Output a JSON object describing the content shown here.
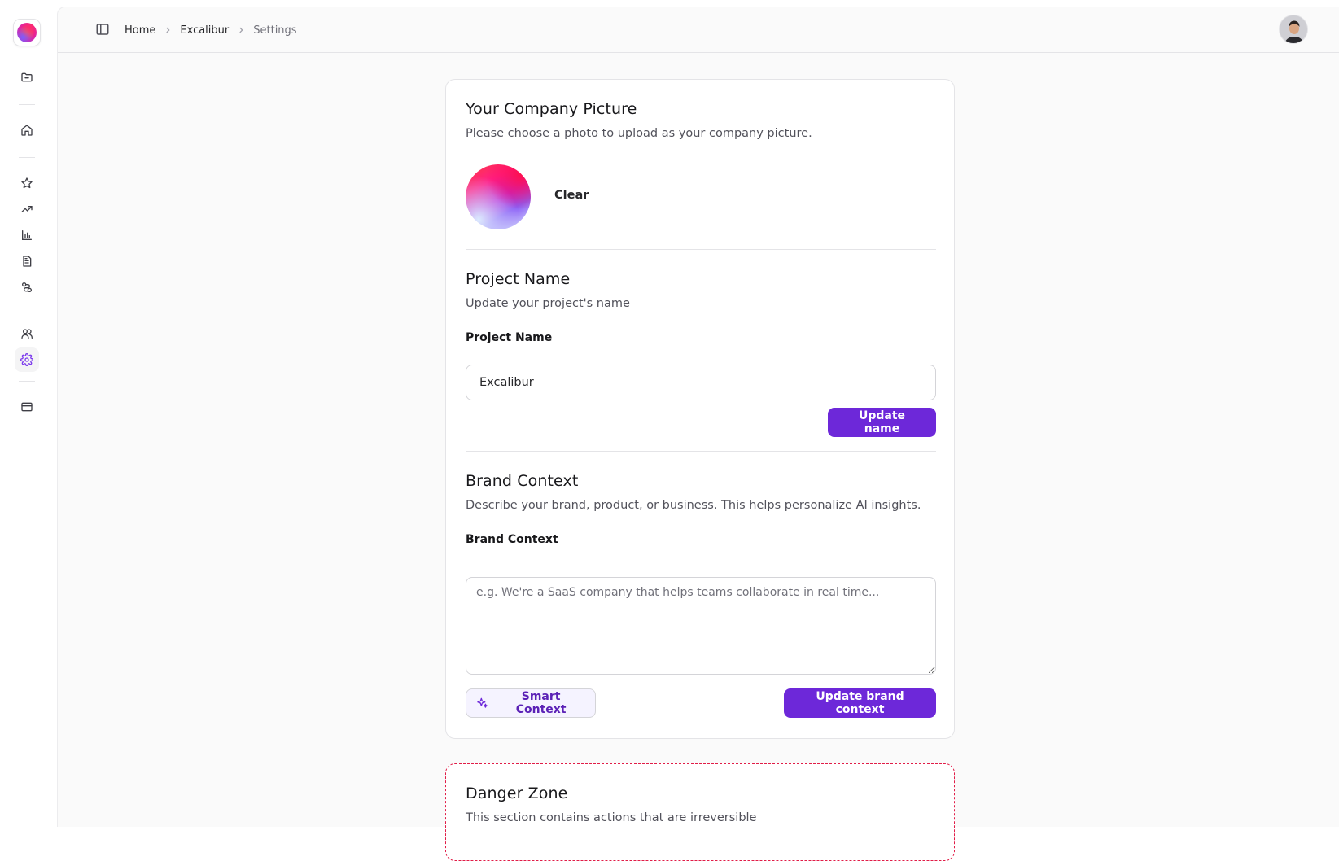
{
  "sidebar": {
    "icons": [
      "folder-icon",
      "home-icon",
      "star-icon",
      "trending-up-icon",
      "bar-chart-icon",
      "document-icon",
      "integrations-icon",
      "users-icon",
      "settings-icon",
      "credit-card-icon"
    ],
    "active": "settings-icon"
  },
  "header": {
    "breadcrumb": [
      "Home",
      "Excalibur",
      "Settings"
    ]
  },
  "company_picture": {
    "title": "Your Company Picture",
    "description": "Please choose a photo to upload as your company picture.",
    "clear_label": "Clear"
  },
  "project_name": {
    "title": "Project Name",
    "description": "Update your project's name",
    "field_label": "Project Name",
    "value": "Excalibur",
    "button_label": "Update name"
  },
  "brand_context": {
    "title": "Brand Context",
    "description": "Describe your brand, product, or business. This helps personalize AI insights.",
    "field_label": "Brand Context",
    "placeholder": "e.g. We're a SaaS company that helps teams collaborate in real time...",
    "smart_button_label": "Smart Context",
    "update_button_label": "Update brand context"
  },
  "danger_zone": {
    "title": "Danger Zone",
    "description": "This section contains actions that are irreversible"
  },
  "colors": {
    "accent": "#6d28d9",
    "danger": "#e11d48"
  }
}
